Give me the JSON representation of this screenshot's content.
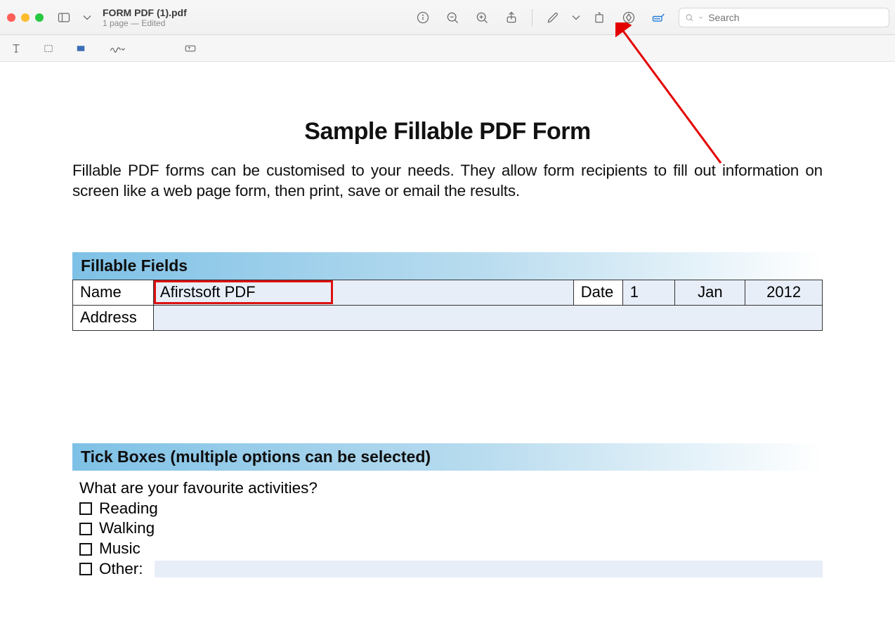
{
  "window": {
    "filename": "FORM PDF (1).pdf",
    "subtitle": "1 page — Edited",
    "search_placeholder": "Search"
  },
  "document": {
    "title": "Sample Fillable PDF Form",
    "intro": "Fillable PDF forms can be customised to your needs. They allow form recipients to fill out information on screen like a web page form, then print, save or email the results.",
    "section1_title": "Fillable Fields",
    "labels": {
      "name": "Name",
      "date": "Date",
      "address": "Address"
    },
    "form": {
      "name_value": "Afirstsoft PDF",
      "date_day": "1",
      "date_month": "Jan",
      "date_year": "2012",
      "address_value": ""
    },
    "section2_title": "Tick Boxes (multiple options can be selected)",
    "question": "What are your favourite activities?",
    "options": [
      "Reading",
      "Walking",
      "Music",
      "Other:"
    ]
  }
}
